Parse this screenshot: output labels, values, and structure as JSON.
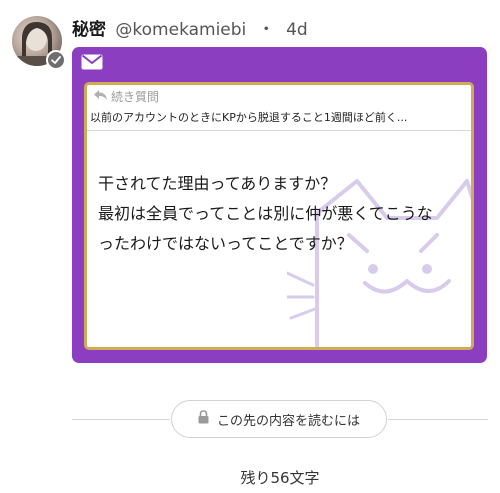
{
  "post": {
    "author_name": "秘密",
    "author_handle": "@komekamiebi",
    "separator": "・",
    "time": "4d"
  },
  "card": {
    "continued_label": "続き質問",
    "previous_question": "以前のアカウントのときにKPから脱退すること1週間ほど前く...",
    "question_line1": "干されてた理由ってありますか？",
    "question_line2": "最初は全員でってことは別に仲が悪くてこうな",
    "question_line3": "ったわけではないってことですか？"
  },
  "read_more": {
    "label": "この先の内容を読むには"
  },
  "remaining": {
    "label": "残り56文字"
  },
  "colors": {
    "card": "#8c3ec0",
    "border": "#cfac55"
  },
  "icons": [
    "avatar",
    "verified-badge-icon",
    "mail-icon",
    "reply-arrow-icon",
    "cat-watermark-icon",
    "lock-icon"
  ]
}
